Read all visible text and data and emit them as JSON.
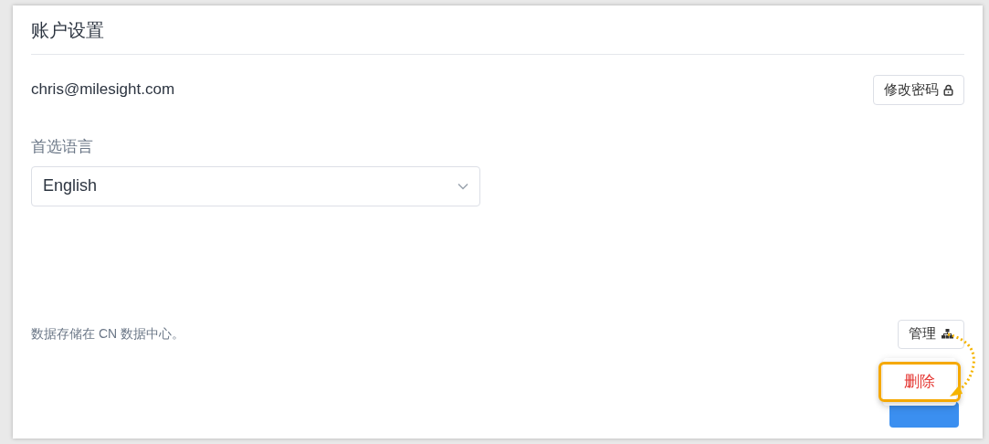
{
  "title": "账户设置",
  "email": "chris@milesight.com",
  "change_password_button": "修改密码",
  "language": {
    "label": "首选语言",
    "value": "English"
  },
  "storage_note": "数据存储在 CN 数据中心。",
  "manage_button": "管理",
  "menu": {
    "items": [
      {
        "label": "删除",
        "kind": "danger",
        "highlighted": true
      }
    ]
  }
}
